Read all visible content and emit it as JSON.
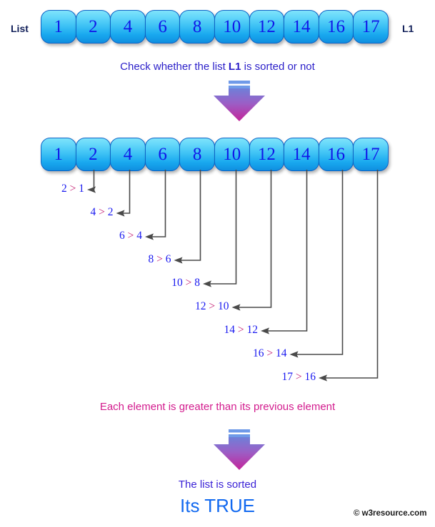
{
  "list": {
    "left_label": "List",
    "right_label": "L1",
    "values": [
      1,
      2,
      4,
      6,
      8,
      10,
      12,
      14,
      16,
      17
    ]
  },
  "captions": {
    "check": {
      "prefix": "Check whether the list ",
      "emphasis": "L1",
      "suffix": " is sorted or not"
    },
    "conclusion": "Each element is greater than its previous element",
    "sorted": "The list is sorted",
    "result": "Its TRUE"
  },
  "comparisons": [
    {
      "left": "2",
      "op": ">",
      "right": "1"
    },
    {
      "left": "4",
      "op": ">",
      "right": "2"
    },
    {
      "left": "6",
      "op": ">",
      "right": "4"
    },
    {
      "left": "8",
      "op": ">",
      "right": "6"
    },
    {
      "left": "10",
      "op": ">",
      "right": "8"
    },
    {
      "left": "12",
      "op": ">",
      "right": "10"
    },
    {
      "left": "14",
      "op": ">",
      "right": "12"
    },
    {
      "left": "16",
      "op": ">",
      "right": "14"
    },
    {
      "left": "17",
      "op": ">",
      "right": "16"
    }
  ],
  "icons": {
    "arrow_down_1": "down-arrow-icon",
    "arrow_down_2": "down-arrow-icon"
  },
  "colors": {
    "cell_border": "#0d63c6",
    "cell_text": "#1117e8",
    "caption_blue": "#2b1fc9",
    "caption_pink": "#d31c8e",
    "result_blue": "#1269f0",
    "compare_number": "#1a1af0",
    "compare_operator": "#c2186e",
    "connector": "#4a4a4a",
    "arrow_top": "#6f7fd8",
    "arrow_bottom": "#c4249a",
    "arrow_bar": "#6f9ae8"
  },
  "footer": {
    "copyright": "© w3resource.com"
  }
}
